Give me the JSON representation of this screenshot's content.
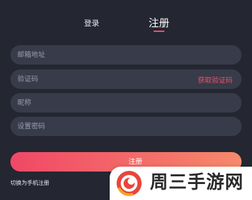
{
  "tabs": {
    "login_label": "登录",
    "register_label": "注册",
    "active": "register"
  },
  "form": {
    "email_placeholder": "邮箱地址",
    "code_placeholder": "验证码",
    "get_code_label": "获取验证码",
    "nickname_placeholder": "昵称",
    "password_placeholder": "设置密码",
    "submit_label": "注册"
  },
  "footer": {
    "switch_label": "切换为手机注册"
  },
  "watermark": {
    "text": "周三手游网"
  },
  "colors": {
    "background": "#242632",
    "field_background": "#383b49",
    "accent": "#f0506b",
    "gradient_end": "#f78a6c",
    "text": "#ffffff"
  }
}
